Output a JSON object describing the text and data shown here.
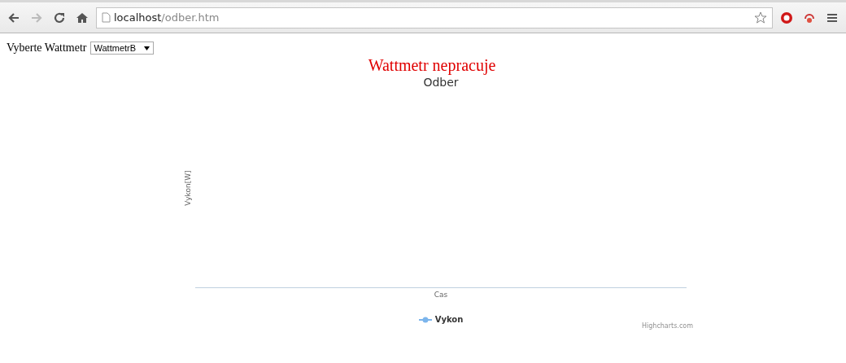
{
  "browser": {
    "url_host": "localhost",
    "url_path": "/odber.htm",
    "bookmarked": false
  },
  "selector": {
    "label": "Vyberte Wattmetr",
    "value": "WattmetrB"
  },
  "status": "Wattmetr nepracuje",
  "chart": {
    "title": "Odber",
    "ylabel": "Vykon[W]",
    "xlabel": "Cas",
    "credits": "Highcharts.com",
    "legend": [
      {
        "name": "Vykon",
        "color": "#7cb5ec"
      }
    ]
  }
}
